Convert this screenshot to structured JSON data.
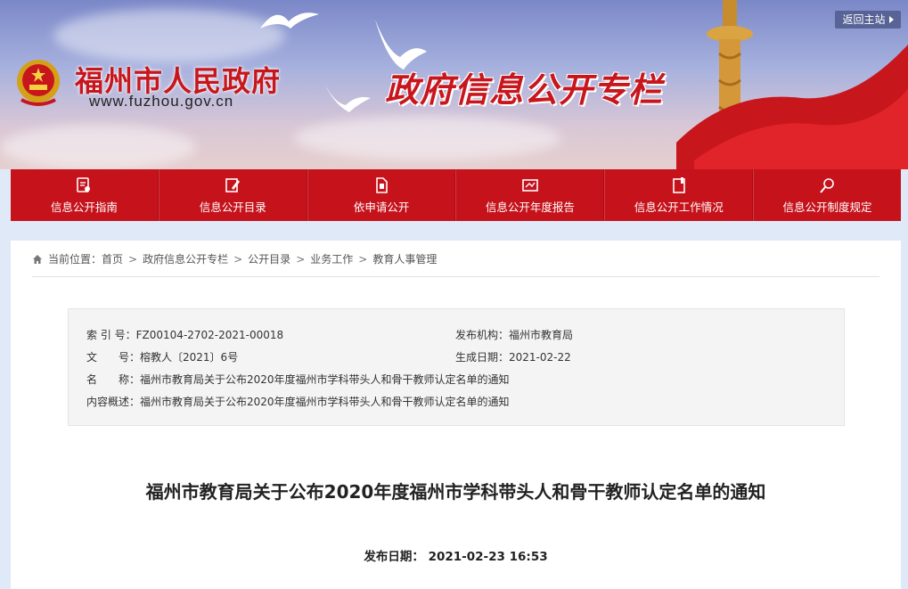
{
  "header": {
    "return_label": "返回主站",
    "site_title": "福州市人民政府",
    "site_url": "www.fuzhou.gov.cn",
    "column_title": "政府信息公开专栏"
  },
  "nav": {
    "items": [
      {
        "label": "信息公开指南",
        "icon": "guide-icon"
      },
      {
        "label": "信息公开目录",
        "icon": "catalog-icon"
      },
      {
        "label": "依申请公开",
        "icon": "apply-document-icon"
      },
      {
        "label": "信息公开年度报告",
        "icon": "annual-report-icon"
      },
      {
        "label": "信息公开工作情况",
        "icon": "work-status-icon"
      },
      {
        "label": "信息公开制度规定",
        "icon": "regulation-search-icon"
      }
    ]
  },
  "breadcrumb": {
    "prefix": "当前位置：",
    "items": [
      "首页",
      "政府信息公开专栏",
      "公开目录",
      "业务工作",
      "教育人事管理"
    ],
    "separator": ">"
  },
  "meta": {
    "index_label": "索 引 号：",
    "index_value": "FZ00104-2702-2021-00018",
    "publisher_label": "发布机构：",
    "publisher_value": "福州市教育局",
    "docno_label": "文　　号：",
    "docno_value": "榕教人〔2021〕6号",
    "gendate_label": "生成日期：",
    "gendate_value": "2021-02-22",
    "name_label": "名　　称：",
    "name_value": "福州市教育局关于公布2020年度福州市学科带头人和骨干教师认定名单的通知",
    "summary_label": "内容概述：",
    "summary_value": "福州市教育局关于公布2020年度福州市学科带头人和骨干教师认定名单的通知"
  },
  "article": {
    "title": "福州市教育局关于公布2020年度福州市学科带头人和骨干教师认定名单的通知",
    "pubdate_label": "发布日期：",
    "pubdate_value": "2021-02-23 16:53"
  },
  "colors": {
    "brand_red": "#c6121b",
    "title_red": "#c8161d"
  }
}
